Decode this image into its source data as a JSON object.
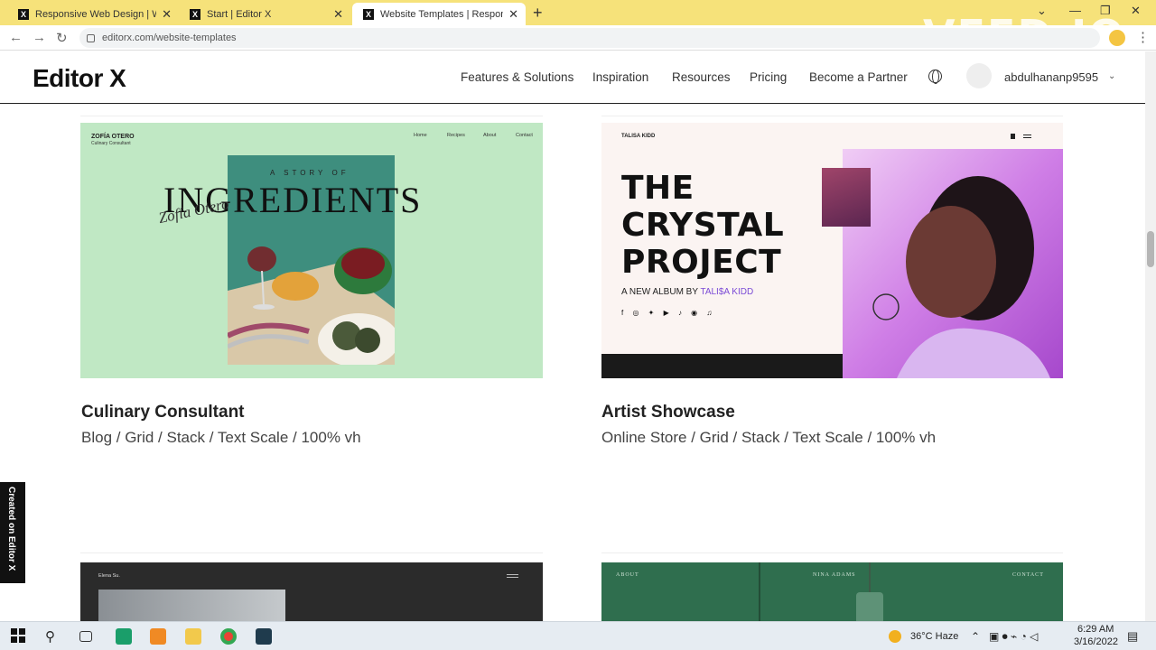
{
  "browser": {
    "tabs": [
      {
        "title": "Responsive Web Design | Websit"
      },
      {
        "title": "Start | Editor X"
      },
      {
        "title": "Website Templates | Responsive"
      }
    ],
    "url": "editorx.com/website-templates",
    "watermark": "VEED.IO"
  },
  "header": {
    "logo": "Editor X",
    "nav": [
      "Features & Solutions",
      "Inspiration",
      "Resources",
      "Pricing",
      "Become a Partner"
    ],
    "username": "abdulhananp9595"
  },
  "cards": [
    {
      "title": "Culinary Consultant",
      "tags": "Blog / Grid / Stack / Text Scale / 100% vh",
      "preview": {
        "brand": "ZOFÍA OTERO",
        "brand_sub": "Culinary Consultant",
        "menu": [
          "Home",
          "Recipes",
          "About",
          "Contact"
        ],
        "story": "A STORY OF",
        "headline": "INGREDIENTS",
        "signature": "Zofía Otero"
      }
    },
    {
      "title": "Artist Showcase",
      "tags": "Online Store / Grid / Stack / Text Scale / 100% vh",
      "preview": {
        "brand": "TALISA KIDD",
        "headline_lines": [
          "THE",
          "CRYSTAL",
          "PROJECT"
        ],
        "sub_prefix": "A NEW ALBUM BY",
        "sub_name": "TALI$A KIDD",
        "social": "f ◎ ✦ ▶ ♪ ◉ ♫"
      }
    },
    {
      "preview": {
        "brand": "Elena Su."
      }
    },
    {
      "preview": {
        "menu": [
          "ABOUT",
          "NINA ADAMS",
          "CONTACT"
        ]
      }
    }
  ],
  "side_badge": "Created on Editor X",
  "taskbar": {
    "weather": "36°C  Haze",
    "time": "6:29 AM",
    "date": "3/16/2022"
  }
}
